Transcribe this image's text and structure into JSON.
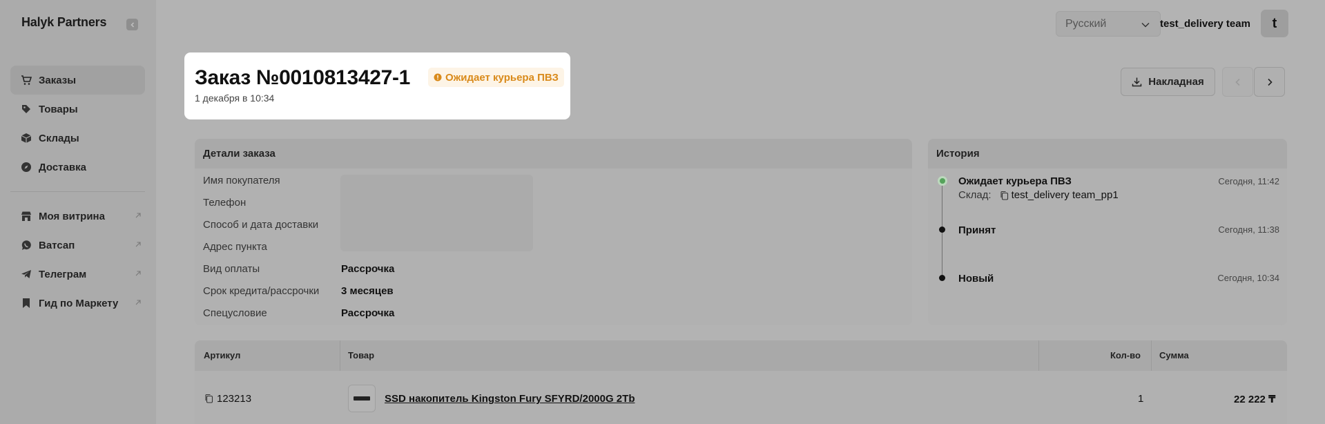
{
  "app": {
    "logo": "Halyk Partners"
  },
  "sidebar": {
    "items": [
      {
        "label": "Заказы",
        "icon": "cart-icon",
        "active": true
      },
      {
        "label": "Товары",
        "icon": "tag-icon"
      },
      {
        "label": "Склады",
        "icon": "box-icon"
      },
      {
        "label": "Доставка",
        "icon": "compass-icon"
      }
    ],
    "links": [
      {
        "label": "Моя витрина",
        "icon": "store-icon"
      },
      {
        "label": "Ватсап",
        "icon": "whatsapp-icon"
      },
      {
        "label": "Телеграм",
        "icon": "telegram-icon"
      },
      {
        "label": "Гид по Маркету",
        "icon": "bookmark-icon"
      }
    ]
  },
  "header": {
    "language": "Русский",
    "user_name": "test_delivery team",
    "avatar_letter": "t"
  },
  "order": {
    "title": "Заказ №0010813427-1",
    "status": "Ожидает курьера ПВЗ",
    "date": "1 декабря в 10:34",
    "invoice_label": "Накладная"
  },
  "details": {
    "heading": "Детали заказа",
    "rows": [
      {
        "label": "Имя покупателя",
        "value": ""
      },
      {
        "label": "Телефон",
        "value": ""
      },
      {
        "label": "Способ и дата доставки",
        "value": ""
      },
      {
        "label": "Адрес пункта",
        "value": ""
      },
      {
        "label": "Вид оплаты",
        "value": "Рассрочка"
      },
      {
        "label": "Срок кредита/рассрочки",
        "value": "3 месяцев"
      },
      {
        "label": "Спецусловие",
        "value": "Рассрочка"
      }
    ]
  },
  "history": {
    "heading": "История",
    "events": [
      {
        "title": "Ожидает курьера ПВЗ",
        "time": "Сегодня, 11:42",
        "sub_label": "Склад:",
        "sub_value": "test_delivery team_pp1"
      },
      {
        "title": "Принят",
        "time": "Сегодня, 11:38"
      },
      {
        "title": "Новый",
        "time": "Сегодня, 10:34"
      }
    ]
  },
  "products": {
    "headers": {
      "sku": "Артикул",
      "product": "Товар",
      "qty": "Кол-во",
      "sum": "Сумма"
    },
    "rows": [
      {
        "sku": "123213",
        "product": "SSD накопитель Kingston Fury SFYRD/2000G 2Tb",
        "qty": "1",
        "sum": "22 222 ₸"
      }
    ]
  },
  "colors": {
    "status": "#d98a1a",
    "status_bg": "#fdf4e6",
    "active_dot": "#55a35b"
  }
}
